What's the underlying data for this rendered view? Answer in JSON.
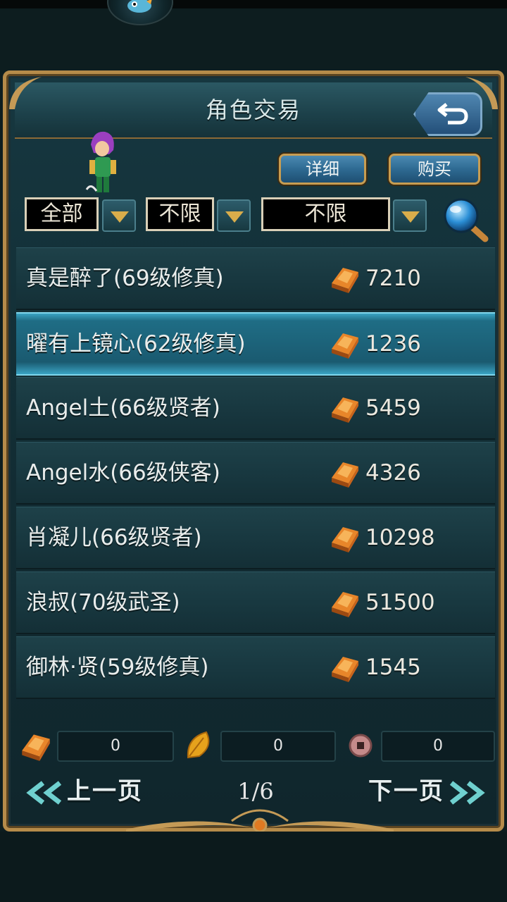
{
  "title": "角色交易",
  "buttons": {
    "detail": "详细",
    "buy": "购买"
  },
  "filters": [
    {
      "value": "全部"
    },
    {
      "value": "不限"
    },
    {
      "value": "不限"
    }
  ],
  "listings": [
    {
      "name": "真是醉了(69级修真)",
      "price": "7210"
    },
    {
      "name": "曜有上镜心(62级修真)",
      "price": "1236"
    },
    {
      "name": "Angel土(66级贤者)",
      "price": "5459"
    },
    {
      "name": "Angel水(66级侠客)",
      "price": "4326"
    },
    {
      "name": "肖凝儿(66级贤者)",
      "price": "10298"
    },
    {
      "name": "浪叔(70级武圣)",
      "price": "51500"
    },
    {
      "name": "御林·贤(59级修真)",
      "price": "1545"
    }
  ],
  "selected_index": 1,
  "currencies": [
    {
      "icon": "gold-ingot-icon",
      "value": "0"
    },
    {
      "icon": "gold-leaf-icon",
      "value": "0"
    },
    {
      "icon": "copper-coin-icon",
      "value": "0"
    }
  ],
  "pager": {
    "prev": "上一页",
    "next": "下一页",
    "indicator": "1/6"
  },
  "colors": {
    "frame_gold": "#b58b4a",
    "selected_row": "#1f6d85",
    "button_blue": "#2e6a92"
  }
}
